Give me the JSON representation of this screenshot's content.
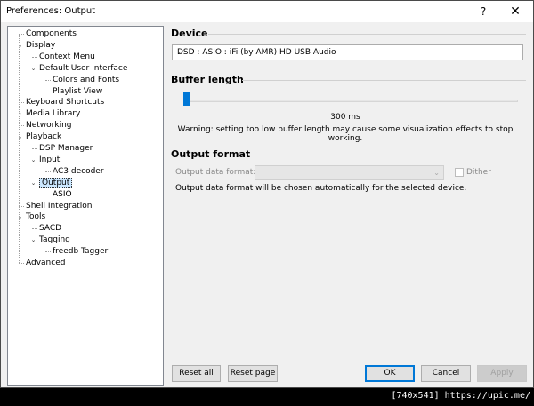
{
  "window": {
    "title": "Preferences: Output",
    "help": "?",
    "close": "✕"
  },
  "tree": [
    {
      "id": "components",
      "label": "Components",
      "level": 0,
      "expander": ""
    },
    {
      "id": "display",
      "label": "Display",
      "level": 0,
      "expander": "v"
    },
    {
      "id": "context-menu",
      "label": "Context Menu",
      "level": 1,
      "expander": ""
    },
    {
      "id": "default-ui",
      "label": "Default User Interface",
      "level": 1,
      "expander": "v"
    },
    {
      "id": "colors-fonts",
      "label": "Colors and Fonts",
      "level": 2,
      "expander": ""
    },
    {
      "id": "playlist-view",
      "label": "Playlist View",
      "level": 2,
      "expander": ""
    },
    {
      "id": "keyboard-shortcuts",
      "label": "Keyboard Shortcuts",
      "level": 0,
      "expander": ""
    },
    {
      "id": "media-library",
      "label": "Media Library",
      "level": 0,
      "expander": ">"
    },
    {
      "id": "networking",
      "label": "Networking",
      "level": 0,
      "expander": ""
    },
    {
      "id": "playback",
      "label": "Playback",
      "level": 0,
      "expander": "v"
    },
    {
      "id": "dsp-manager",
      "label": "DSP Manager",
      "level": 1,
      "expander": ""
    },
    {
      "id": "input",
      "label": "Input",
      "level": 1,
      "expander": "v"
    },
    {
      "id": "ac3-decoder",
      "label": "AC3 decoder",
      "level": 2,
      "expander": ""
    },
    {
      "id": "output",
      "label": "Output",
      "level": 1,
      "expander": "v",
      "selected": true
    },
    {
      "id": "asio",
      "label": "ASIO",
      "level": 2,
      "expander": ""
    },
    {
      "id": "shell-integration",
      "label": "Shell Integration",
      "level": 0,
      "expander": ""
    },
    {
      "id": "tools",
      "label": "Tools",
      "level": 0,
      "expander": "v"
    },
    {
      "id": "sacd",
      "label": "SACD",
      "level": 1,
      "expander": ""
    },
    {
      "id": "tagging",
      "label": "Tagging",
      "level": 1,
      "expander": "v"
    },
    {
      "id": "freedb-tagger",
      "label": "freedb Tagger",
      "level": 2,
      "expander": ""
    },
    {
      "id": "advanced",
      "label": "Advanced",
      "level": 0,
      "expander": ""
    }
  ],
  "device": {
    "heading": "Device",
    "selected": "DSD : ASIO : iFi (by AMR) HD USB Audio"
  },
  "buffer": {
    "heading": "Buffer length",
    "value_label": "300 ms",
    "fraction": 0.0,
    "warning": "Warning: setting too low buffer length may cause some visualization effects to stop working."
  },
  "output_format": {
    "heading": "Output format",
    "data_format_label": "Output data format:",
    "data_format_value": "",
    "dither_label": "Dither",
    "dither_checked": false,
    "info": "Output data format will be chosen automatically for the selected device."
  },
  "buttons": {
    "reset_all": "Reset all",
    "reset_page": "Reset page",
    "ok": "OK",
    "cancel": "Cancel",
    "apply": "Apply"
  },
  "watermark": "[740x541] https://upic.me/"
}
